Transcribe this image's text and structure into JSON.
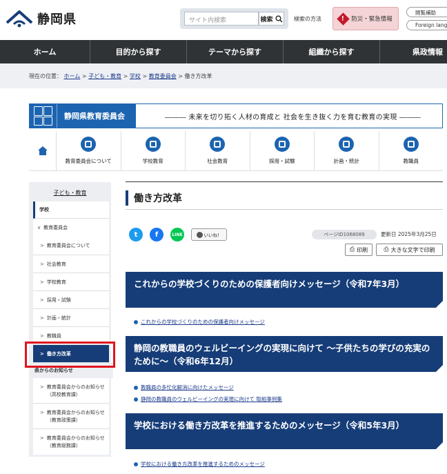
{
  "header": {
    "logo_text": "静岡県",
    "search_placeholder": "サイト内検索",
    "search_button": "検索",
    "search_howto": "検索の方法",
    "emergency": "防災・緊急情報",
    "pill_1": "閲覧補助",
    "pill_2": "Foreign lang"
  },
  "nav": [
    "ホーム",
    "目的から探す",
    "テーマから探す",
    "組織から探す",
    "県政情報"
  ],
  "breadcrumb": {
    "prefix": "現在の位置：",
    "items": [
      "ホーム",
      "子ども・教育",
      "学校",
      "教育委員会"
    ],
    "sep": ">",
    "current": "働き方改革"
  },
  "banner": {
    "title": "静岡県教育委員会",
    "tagline": "――― 未来を切り拓く人材の育成と 社会を生き抜く力を育む教育の実現 ―――"
  },
  "icon_nav": [
    {
      "label": "教育委員会について",
      "icon": "building-icon"
    },
    {
      "label": "学校教育",
      "icon": "book-icon"
    },
    {
      "label": "社会教育",
      "icon": "device-icon"
    },
    {
      "label": "採用・試験",
      "icon": "pencil-icon"
    },
    {
      "label": "計画・統計",
      "icon": "chart-icon"
    },
    {
      "label": "教職員",
      "icon": "teacher-icon"
    }
  ],
  "sidebar": {
    "top": "子ども・教育",
    "items": [
      {
        "label": "学校",
        "type": "head"
      },
      {
        "label": "教育委員会",
        "type": "open"
      },
      {
        "label": "教育委員会について",
        "type": "item"
      },
      {
        "label": "社会教育",
        "type": "item"
      },
      {
        "label": "学校教育",
        "type": "item"
      },
      {
        "label": "採用・試験",
        "type": "item"
      },
      {
        "label": "計画・統計",
        "type": "item"
      },
      {
        "label": "教職員",
        "type": "item"
      },
      {
        "label": "働き方改革",
        "type": "selected"
      },
      {
        "label": "県からのお知らせ",
        "type": "section"
      },
      {
        "label": "教育委員会からのお知らせ（高校教育課）",
        "type": "item"
      },
      {
        "label": "教育委員会からのお知らせ（教育政策課）",
        "type": "item"
      },
      {
        "label": "教育委員会からのお知らせ（教育総務課）",
        "type": "item"
      }
    ]
  },
  "main": {
    "title": "働き方改革",
    "like": "いいね！",
    "page_id": "ページID1068089",
    "updated": "更新日 2025年3月25日",
    "print": "印刷",
    "print_large": "大きな文字で印刷",
    "sections": [
      {
        "heading": "これからの学校づくりのための保護者向けメッセージ（令和7年3月）",
        "links": [
          "これからの学校づくりのための保護者向けメッセージ"
        ]
      },
      {
        "heading": "静岡の教職員のウェルビーイングの実現に向けて ～子供たちの学びの充実のために～（令和6年12月）",
        "links": [
          "教職員の多忙化解消に向けたメッセージ",
          "静岡の教職員のウェルビーイングの実現に向けて 取組事例集"
        ]
      },
      {
        "heading": "学校における働き方改革を推進するためのメッセージ（令和5年3月）",
        "links": [
          "学校における働き方改革を推進するためのメッセージ"
        ]
      }
    ]
  },
  "colors": {
    "navy": "#163d78",
    "blue": "#1c64b0",
    "nav_bg": "#2f3336",
    "highlight": "#e0141e"
  }
}
